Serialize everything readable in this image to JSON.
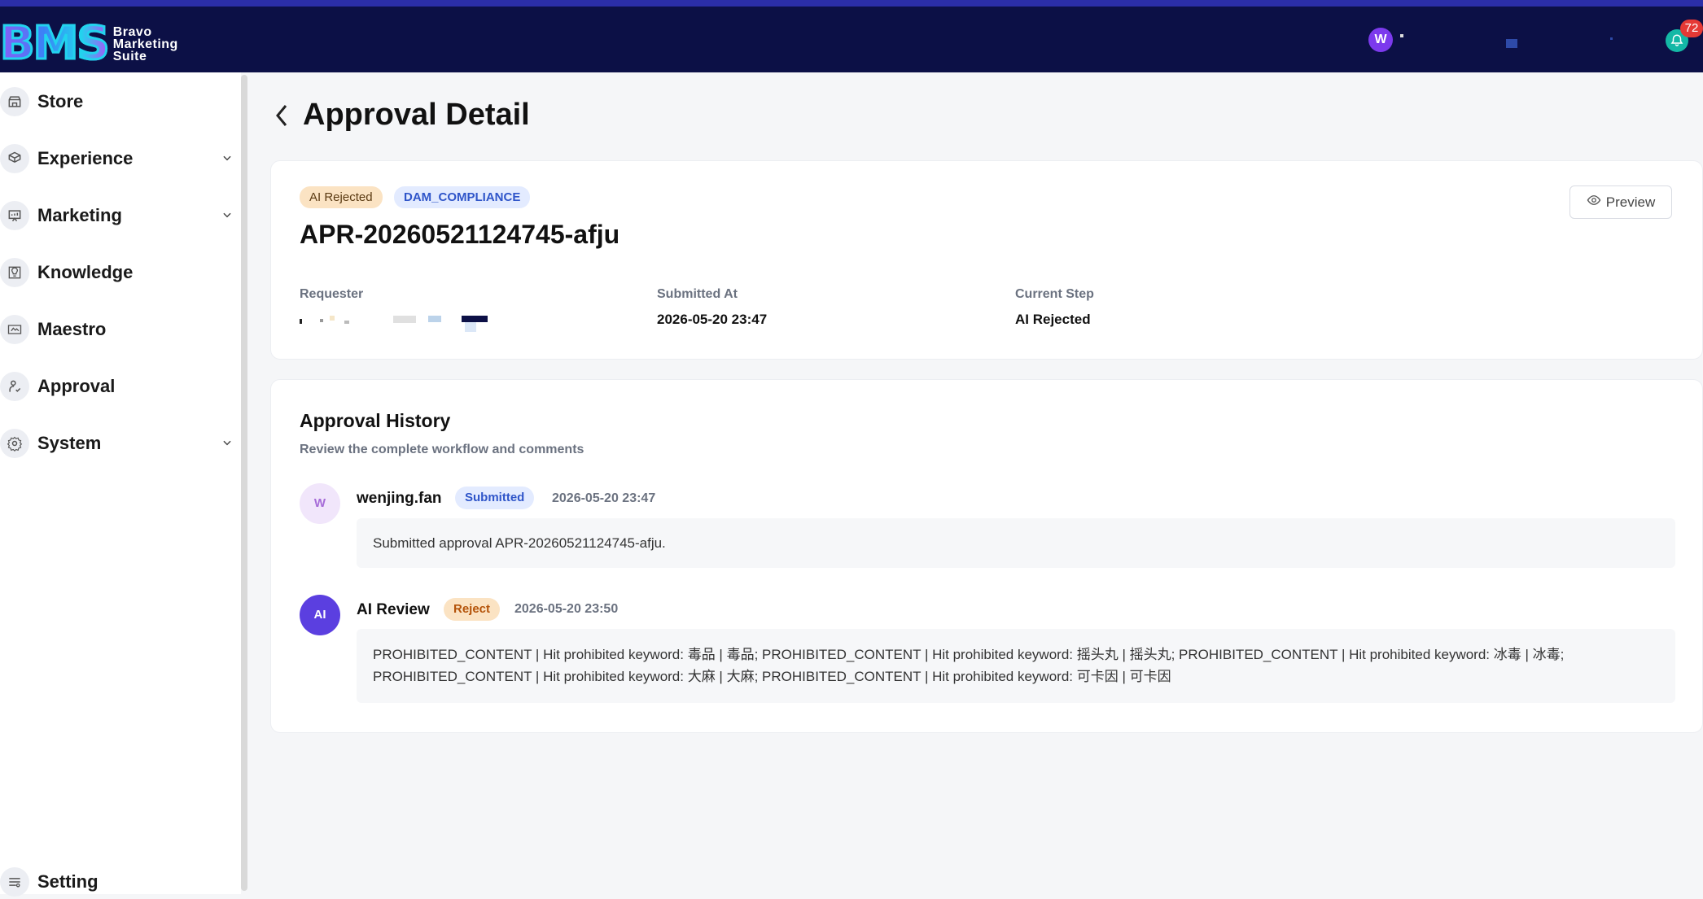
{
  "header": {
    "brand_mark": "BMS",
    "brand_line1": "Bravo",
    "brand_line2": "Marketing",
    "brand_line3": "Suite",
    "user_initial": "W",
    "notification_count": "72"
  },
  "sidebar": {
    "items": [
      {
        "label": "Store",
        "icon": "store-icon"
      },
      {
        "label": "Experience",
        "icon": "experience-icon"
      },
      {
        "label": "Marketing",
        "icon": "marketing-icon"
      },
      {
        "label": "Knowledge",
        "icon": "knowledge-icon"
      },
      {
        "label": "Maestro",
        "icon": "maestro-icon"
      },
      {
        "label": "Approval",
        "icon": "approval-icon"
      },
      {
        "label": "System",
        "icon": "system-icon"
      }
    ],
    "setting_label": "Setting"
  },
  "page": {
    "title": "Approval Detail"
  },
  "summary": {
    "status_tag": "AI Rejected",
    "type_tag": "DAM_COMPLIANCE",
    "approval_id": "APR-20260521124745-afju",
    "preview_label": "Preview",
    "requester_label": "Requester",
    "submitted_at_label": "Submitted At",
    "submitted_at_value": "2026-05-20 23:47",
    "current_step_label": "Current Step",
    "current_step_value": "AI Rejected"
  },
  "history": {
    "title": "Approval History",
    "subtitle": "Review the complete workflow and comments",
    "entries": [
      {
        "avatar": "W",
        "name": "wenjing.fan",
        "action": "Submitted",
        "time": "2026-05-20 23:47",
        "comment": "Submitted approval APR-20260521124745-afju."
      },
      {
        "avatar": "AI",
        "name": "AI Review",
        "action": "Reject",
        "time": "2026-05-20 23:50",
        "comment_line1": "PROHIBITED_CONTENT | Hit prohibited keyword: 毒品 | 毒品; PROHIBITED_CONTENT | Hit prohibited keyword: 摇头丸 | 摇头丸; PROHIBITED_CONTENT | Hit prohibited keyword: 冰毒 | 冰毒;",
        "comment_line2": "PROHIBITED_CONTENT | Hit prohibited keyword: 大麻 | 大麻; PROHIBITED_CONTENT | Hit prohibited keyword: 可卡因 | 可卡因"
      }
    ]
  }
}
